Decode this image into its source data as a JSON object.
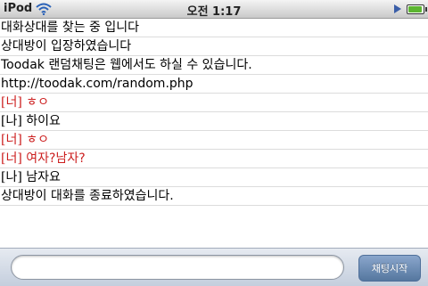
{
  "status_bar": {
    "carrier": "iPod",
    "time": "오전 1:17",
    "wifi_icon": "wifi-icon",
    "battery_level": 0.9
  },
  "chat": {
    "messages": [
      {
        "kind": "system",
        "text": "대화상대를 찾는 중 입니다"
      },
      {
        "kind": "system",
        "text": "상대방이 입장하였습니다"
      },
      {
        "kind": "system",
        "text": "Toodak 랜덤채팅은 웹에서도 하실 수 있습니다."
      },
      {
        "kind": "system",
        "text": "http://toodak.com/random.php"
      },
      {
        "kind": "partner",
        "prefix": "[너]",
        "text": "ㅎㅇ"
      },
      {
        "kind": "me",
        "prefix": "[나]",
        "text": "하이요"
      },
      {
        "kind": "partner",
        "prefix": "[너]",
        "text": "ㅎㅇ"
      },
      {
        "kind": "partner",
        "prefix": "[너]",
        "text": "여자?남자?"
      },
      {
        "kind": "me",
        "prefix": "[나]",
        "text": "남자요"
      },
      {
        "kind": "system",
        "text": "상대방이 대화를 종료하였습니다."
      }
    ]
  },
  "input_bar": {
    "message_value": "",
    "start_button_label": "채팅시작"
  },
  "colors": {
    "partner": "#cc1f1f",
    "me": "#000000",
    "button": "#55779f"
  }
}
